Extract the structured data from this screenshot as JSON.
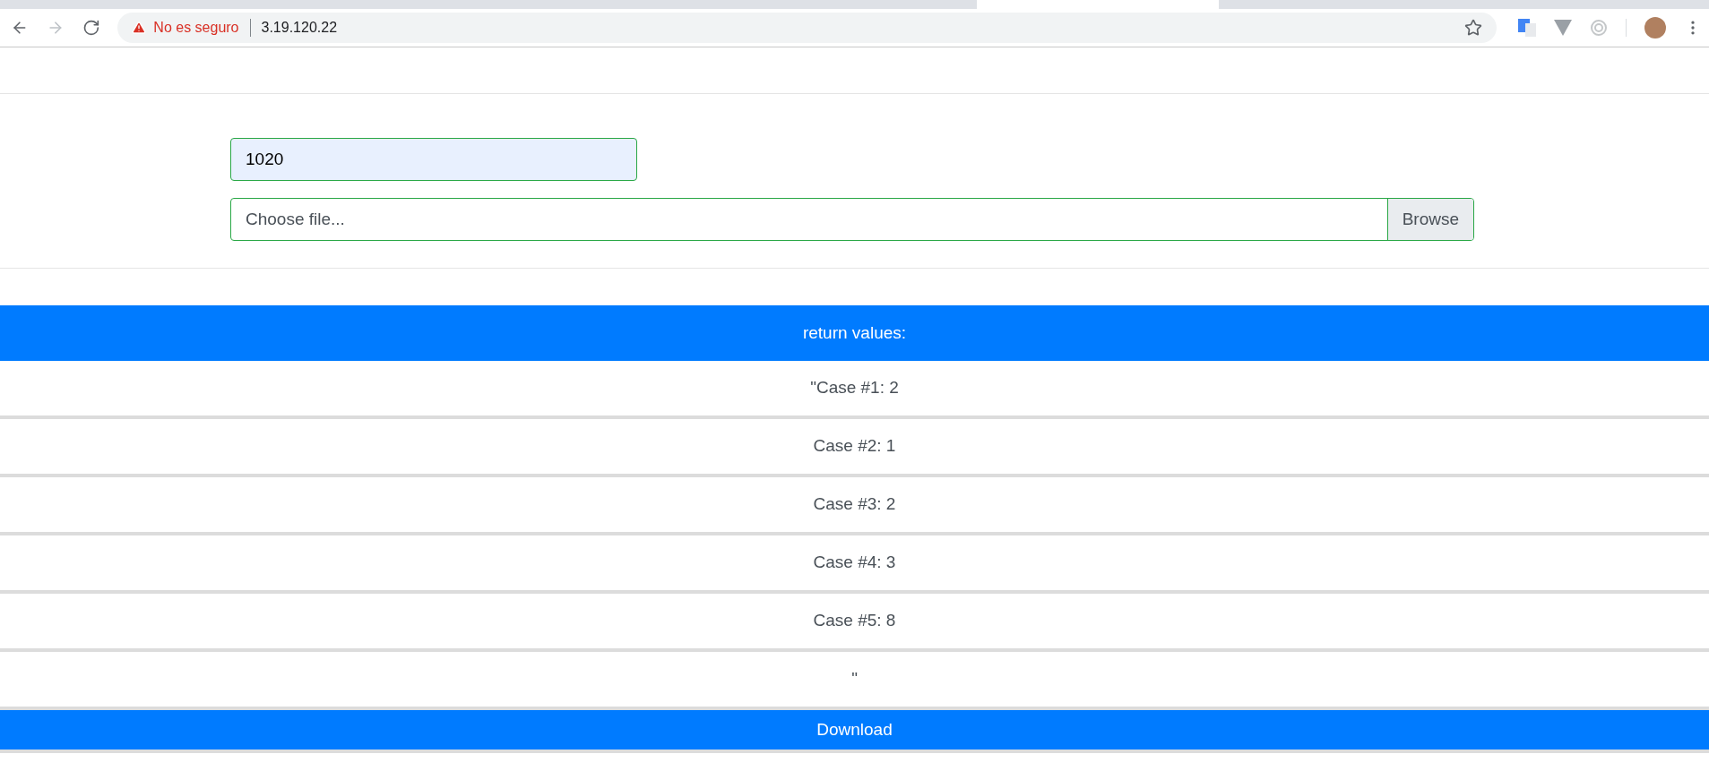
{
  "browser": {
    "security_label": "No es seguro",
    "url": "3.19.120.22"
  },
  "form": {
    "number_field": {
      "value": "1020"
    },
    "file_field": {
      "placeholder": "Choose file...",
      "button": "Browse"
    }
  },
  "results": {
    "header": "return values:",
    "rows": [
      "\"Case #1: 2",
      "Case #2: 1",
      "Case #3: 2",
      "Case #4: 3",
      "Case #5: 8",
      "\""
    ]
  },
  "download_button": "Download"
}
